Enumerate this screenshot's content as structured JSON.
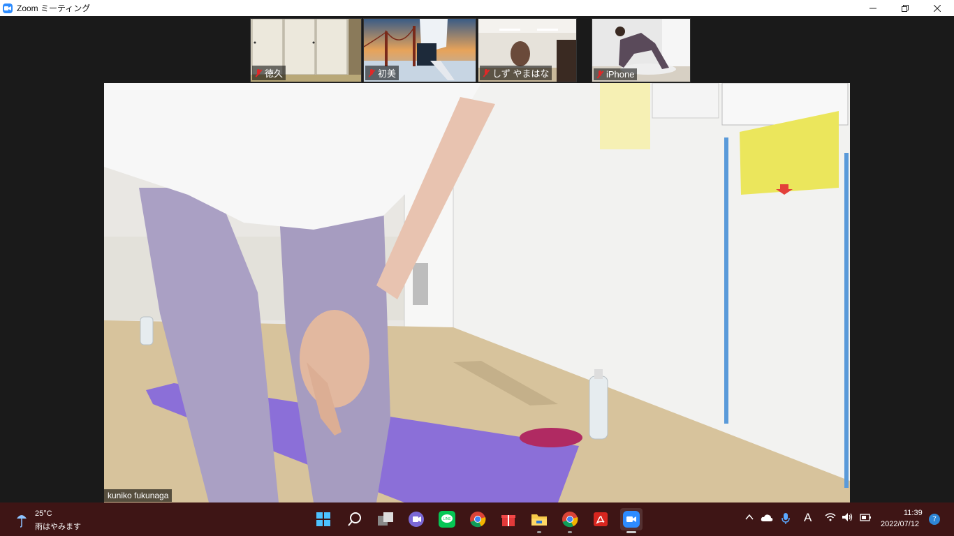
{
  "window": {
    "title": "Zoom ミーティング"
  },
  "participants": [
    {
      "name": "徳久",
      "muted": true
    },
    {
      "name": "初美",
      "muted": true
    },
    {
      "name": "しず やまはな",
      "muted": true
    },
    {
      "name": "iPhone",
      "muted": true
    }
  ],
  "active_speaker": {
    "name": "kuniko fukunaga"
  },
  "taskbar": {
    "weather": {
      "temp": "25°C",
      "desc": "雨はやみます"
    },
    "clock": {
      "time": "11:39",
      "date": "2022/07/12"
    },
    "notification_count": "7",
    "ime": "A",
    "apps": [
      "start-icon",
      "search-icon",
      "task-view-icon",
      "teams-icon",
      "line-icon",
      "chrome-icon",
      "gift-icon",
      "file-explorer-icon",
      "chrome-icon",
      "acrobat-icon",
      "zoom-icon"
    ]
  }
}
